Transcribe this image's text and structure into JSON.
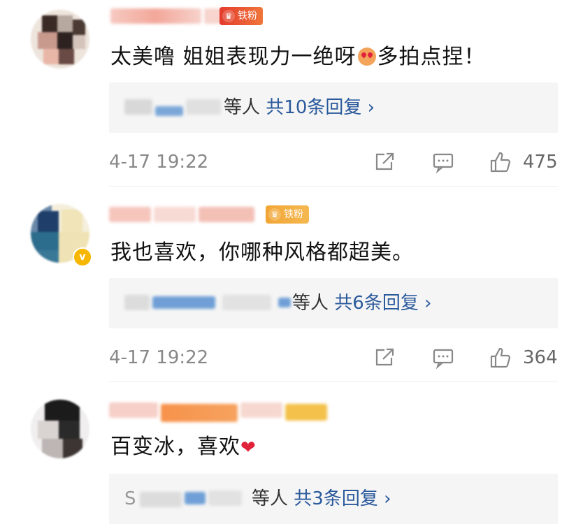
{
  "comments": [
    {
      "fan_badge": "铁粉",
      "text_before": "太美噜 姐姐表现力一绝呀",
      "text_after": "多拍点捏！",
      "reply_who": "等人",
      "reply_count": "共10条回复 ›",
      "time": "4-17 19:22",
      "likes": "475",
      "icons": [
        "share-icon",
        "comment-icon",
        "like-icon"
      ]
    },
    {
      "fan_badge": "铁粉",
      "text": "我也喜欢，你哪种风格都超美。",
      "reply_who": "等人",
      "reply_count": "共6条回复 ›",
      "time": "4-17 19:22",
      "likes": "364",
      "icons": [
        "share-icon",
        "comment-icon",
        "like-icon"
      ]
    },
    {
      "text": "百变冰，喜欢",
      "reply_who": "等人",
      "reply_count": "共3条回复 ›",
      "reply_prefix": "S"
    }
  ],
  "colors": {
    "link_blue": "#2b5a9c",
    "reply_bg": "#f5f5f5",
    "meta_gray": "#888888",
    "fan_badge_red": "#e8532f",
    "fan_badge_orange": "#f0a23a"
  }
}
